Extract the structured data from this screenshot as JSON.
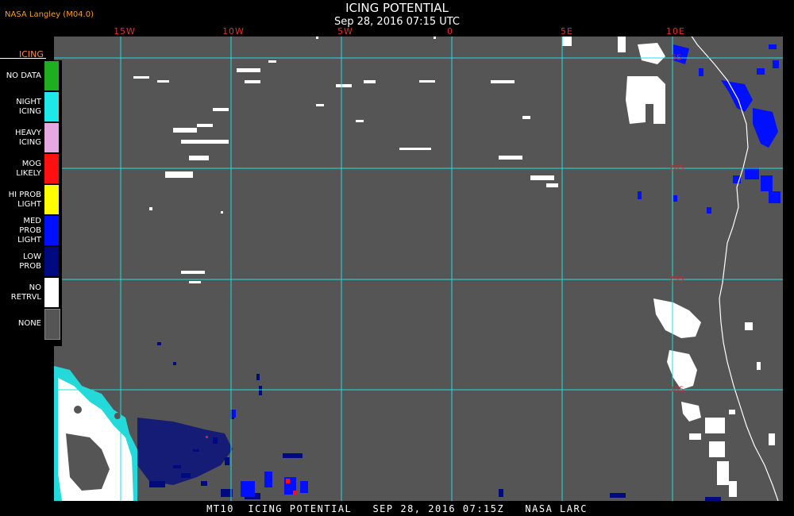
{
  "header": {
    "credit": "NASA Langley (M04.0)",
    "title": "ICING POTENTIAL",
    "subtitle": "Sep 28, 2016 07:15 UTC"
  },
  "legend": {
    "title": "ICING",
    "items": [
      {
        "label": "NO DATA",
        "color": "#1fae1f"
      },
      {
        "label": "NIGHT ICING",
        "color": "#1fe8e8"
      },
      {
        "label": "HEAVY ICING",
        "color": "#e6a8e0"
      },
      {
        "label": "MOG LIKELY",
        "color": "#ff1010"
      },
      {
        "label": "HI PROB LIGHT",
        "color": "#ffff00"
      },
      {
        "label": "MED PROB LIGHT",
        "color": "#0010ff"
      },
      {
        "label": "LOW PROB",
        "color": "#000a80"
      },
      {
        "label": "NO RETRVL",
        "color": "#ffffff"
      },
      {
        "label": "NONE",
        "color": "#555555"
      }
    ]
  },
  "grid": {
    "longitudes": [
      "15W",
      "10W",
      "5W",
      "0",
      "5E",
      "10E"
    ],
    "latitudes": [
      "5S",
      "20S",
      "25S",
      "30S"
    ],
    "line_color": "#20e0e0"
  },
  "footer": {
    "text": "MT10  ICING POTENTIAL   SEP 28, 2016 07:15Z   NASA LARC"
  },
  "colors": {
    "background": "#555555",
    "coastline": "#ffffff",
    "no_retrieval": "#ffffff",
    "low_prob": "#000a80",
    "med_prob_light": "#0010ff",
    "night_icing": "#1fe8e8",
    "mog_likely": "#ff1010"
  }
}
